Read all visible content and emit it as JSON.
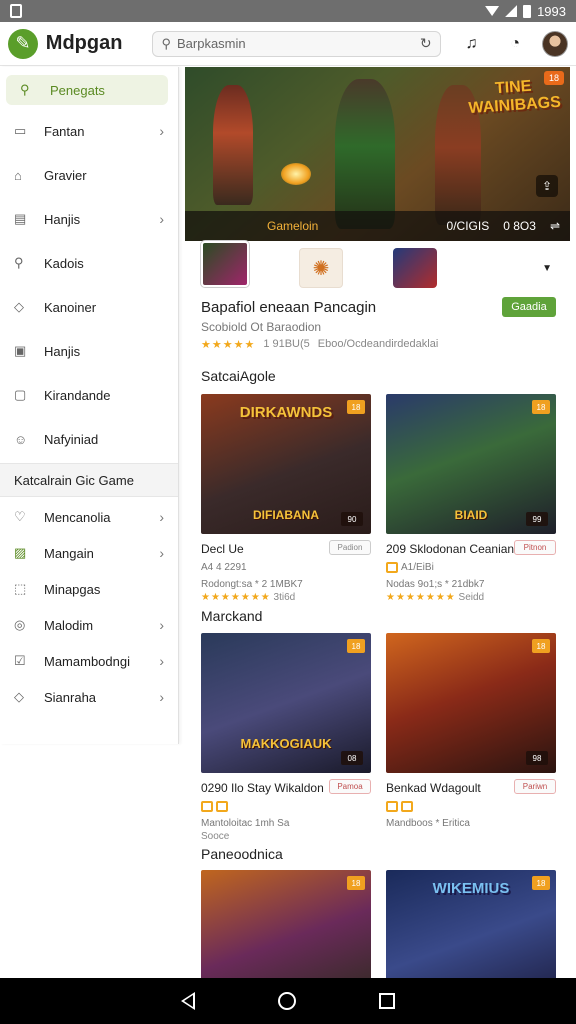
{
  "status_bar": {
    "time": "1993"
  },
  "app": {
    "title": "Mdpgan"
  },
  "search": {
    "placeholder": "Barpkasmin"
  },
  "sidebar": {
    "items": [
      {
        "label": "Penegats",
        "icon": "search-icon"
      },
      {
        "label": "Fantan",
        "icon": "image-icon"
      },
      {
        "label": "Gravier",
        "icon": "home-icon"
      },
      {
        "label": "Hanjis",
        "icon": "list-icon"
      },
      {
        "label": "Kadois",
        "icon": "search-icon"
      },
      {
        "label": "Kanoiner",
        "icon": "shield-icon"
      },
      {
        "label": "Hanjis",
        "icon": "box-icon"
      },
      {
        "label": "Kirandande",
        "icon": "edit-icon"
      },
      {
        "label": "Nafyiniad",
        "icon": "user-icon"
      }
    ],
    "section_label": "Katcalrain Gic Game",
    "section_items": [
      {
        "label": "Mencanolia",
        "icon": "heart-icon"
      },
      {
        "label": "Mangain",
        "icon": "chart-icon"
      },
      {
        "label": "Minapgas",
        "icon": "box-icon"
      },
      {
        "label": "Malodim",
        "icon": "circle-icon"
      },
      {
        "label": "Mamambodngi",
        "icon": "check-icon"
      },
      {
        "label": "Sianraha",
        "icon": "diamond-icon"
      }
    ]
  },
  "hero": {
    "title": "Gameloin",
    "logo_text": "TINE WAINIBAGS",
    "badge": "18",
    "stat1": "0/CIGIS",
    "stat2": "0 8O3"
  },
  "featured": {
    "title": "Bapafiol eneaan Pancagin",
    "subtitle": "Scobiold Ot Baraodion",
    "meta1": "1 91BU(5",
    "meta2": "Eboo/Ocdeandirdedaklai",
    "button": "Gaadia"
  },
  "sections": [
    {
      "title": "SatcaiAgole"
    },
    {
      "title": "Marckand"
    },
    {
      "title": "Paneoodnica"
    }
  ],
  "cards": [
    {
      "name": "Decl Ue",
      "button": "Padion",
      "tag": "18",
      "price": "90",
      "title": "DIRKAWNDS",
      "subtitle": "DIFIABANA",
      "l1": "A4 4 2291",
      "l2": "Rodongt:sa * 2 1MBK7",
      "l3": "3ti6d"
    },
    {
      "name": "209 Sklodonan Ceanian",
      "button": "Pitnon",
      "tag": "18",
      "price": "99",
      "title": "",
      "subtitle": "BIAID",
      "l1": "A1/EiBi",
      "l2": "Nodas 9o1;s * 21dbk7",
      "l3": "Seidd"
    },
    {
      "name": "0290 Ilo Stay Wikaldon",
      "button": "Pamoa",
      "tag": "18",
      "price": "08",
      "title": "",
      "subtitle": "MAKKOGIAUK",
      "l1": "",
      "l2": "Mantoloitac 1mh Sa",
      "l3": "Sooce"
    },
    {
      "name": "Benkad Wdagoult",
      "button": "Pariwn",
      "tag": "18",
      "price": "98",
      "title": "",
      "subtitle": "",
      "l1": "",
      "l2": "Mandboos * Eritica",
      "l3": ""
    },
    {
      "name": "",
      "button": "",
      "tag": "18",
      "price": "",
      "title": "",
      "subtitle": "",
      "l1": "",
      "l2": "",
      "l3": ""
    },
    {
      "name": "",
      "button": "",
      "tag": "18",
      "price": "",
      "title": "WIKEMIUS",
      "subtitle": "",
      "l1": "",
      "l2": "",
      "l3": ""
    }
  ],
  "colors": {
    "accent": "#5fa33a",
    "star": "#f2a81c",
    "tag": "#f0a020"
  }
}
